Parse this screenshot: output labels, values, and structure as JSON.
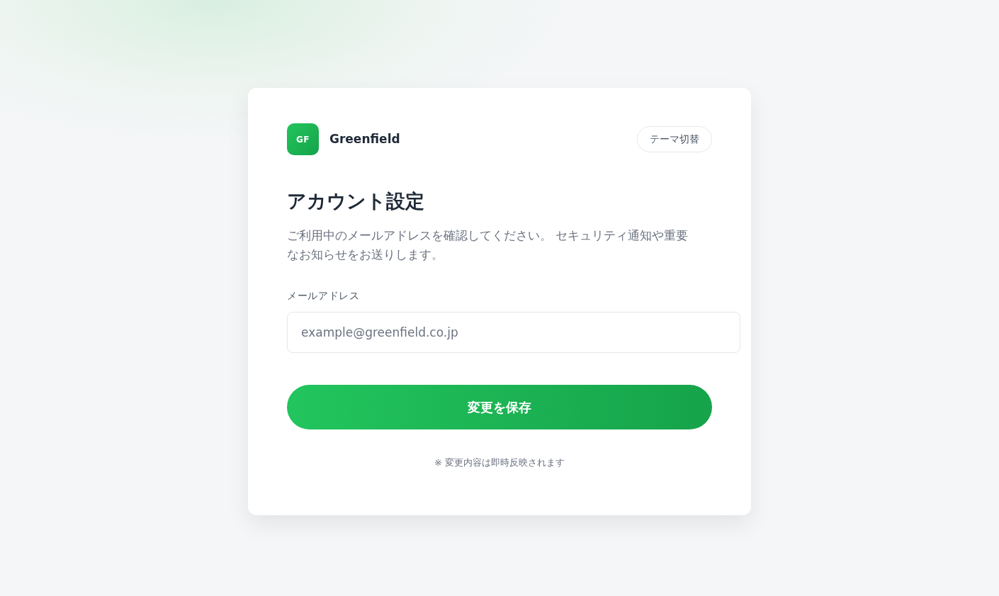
{
  "brand": {
    "logo": "GF",
    "name": "Greenfield"
  },
  "theme_button": "テーマ切替",
  "title": "アカウント設定",
  "description": "ご利用中のメールアドレスを確認してください。 セキュリティ通知や重要なお知らせをお送りします。",
  "email": {
    "label": "メールアドレス",
    "placeholder": "example@greenfield.co.jp"
  },
  "save_button": "変更を保存",
  "note": "※ 変更内容は即時反映されます"
}
